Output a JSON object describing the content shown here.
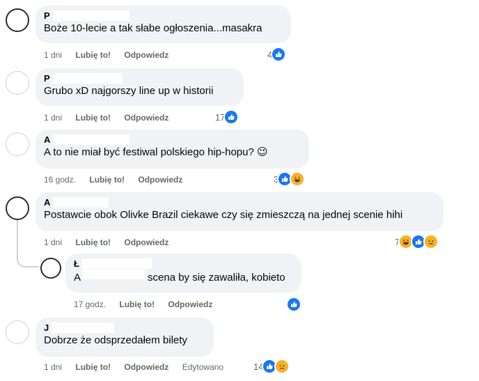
{
  "labels": {
    "like": "Lubię to!",
    "reply": "Odpowiedz",
    "edited": "Edytowano"
  },
  "comments": [
    {
      "author": "P",
      "text": "Boże 10-lecie a tak słabe ogłoszenia...masakra",
      "time": "1 dni",
      "reaction_count": "4",
      "reactions": [
        "like-icon"
      ]
    },
    {
      "author": "P",
      "text": "Grubo xD najgorszy line up w historii",
      "time": "1 dni",
      "reaction_count": "17",
      "reactions": [
        "like-icon"
      ]
    },
    {
      "author": "A",
      "text": "A to nie miał być festiwal polskiego hip-hopu? 😉",
      "time": "16 godz.",
      "reaction_count": "3",
      "reactions": [
        "like-icon",
        "haha-icon"
      ]
    },
    {
      "author": "A",
      "text": "Postawcie obok Olivke Brazil ciekawe czy się zmieszczą na jednej scenie hihi",
      "time": "1 dni",
      "reaction_count": "7",
      "reactions": [
        "haha-icon",
        "like-icon",
        "sad-icon"
      ],
      "reply": {
        "author": "Ł",
        "mention": "A",
        "text": "scena by się zawaliła, kobieto",
        "time": "17 godz.",
        "reaction_count": "",
        "reactions": [
          "like-icon"
        ]
      }
    },
    {
      "author": "J",
      "text": "Dobrze że odsprzedałem bilety",
      "time": "1 dni",
      "edited": true,
      "reaction_count": "14",
      "reactions": [
        "like-icon",
        "sad-icon"
      ]
    }
  ],
  "colors": {
    "bubble": "#f0f2f5",
    "like_blue": "#1877f2",
    "emoji_yellow": "#f7b125",
    "meta_gray": "#65676b"
  }
}
